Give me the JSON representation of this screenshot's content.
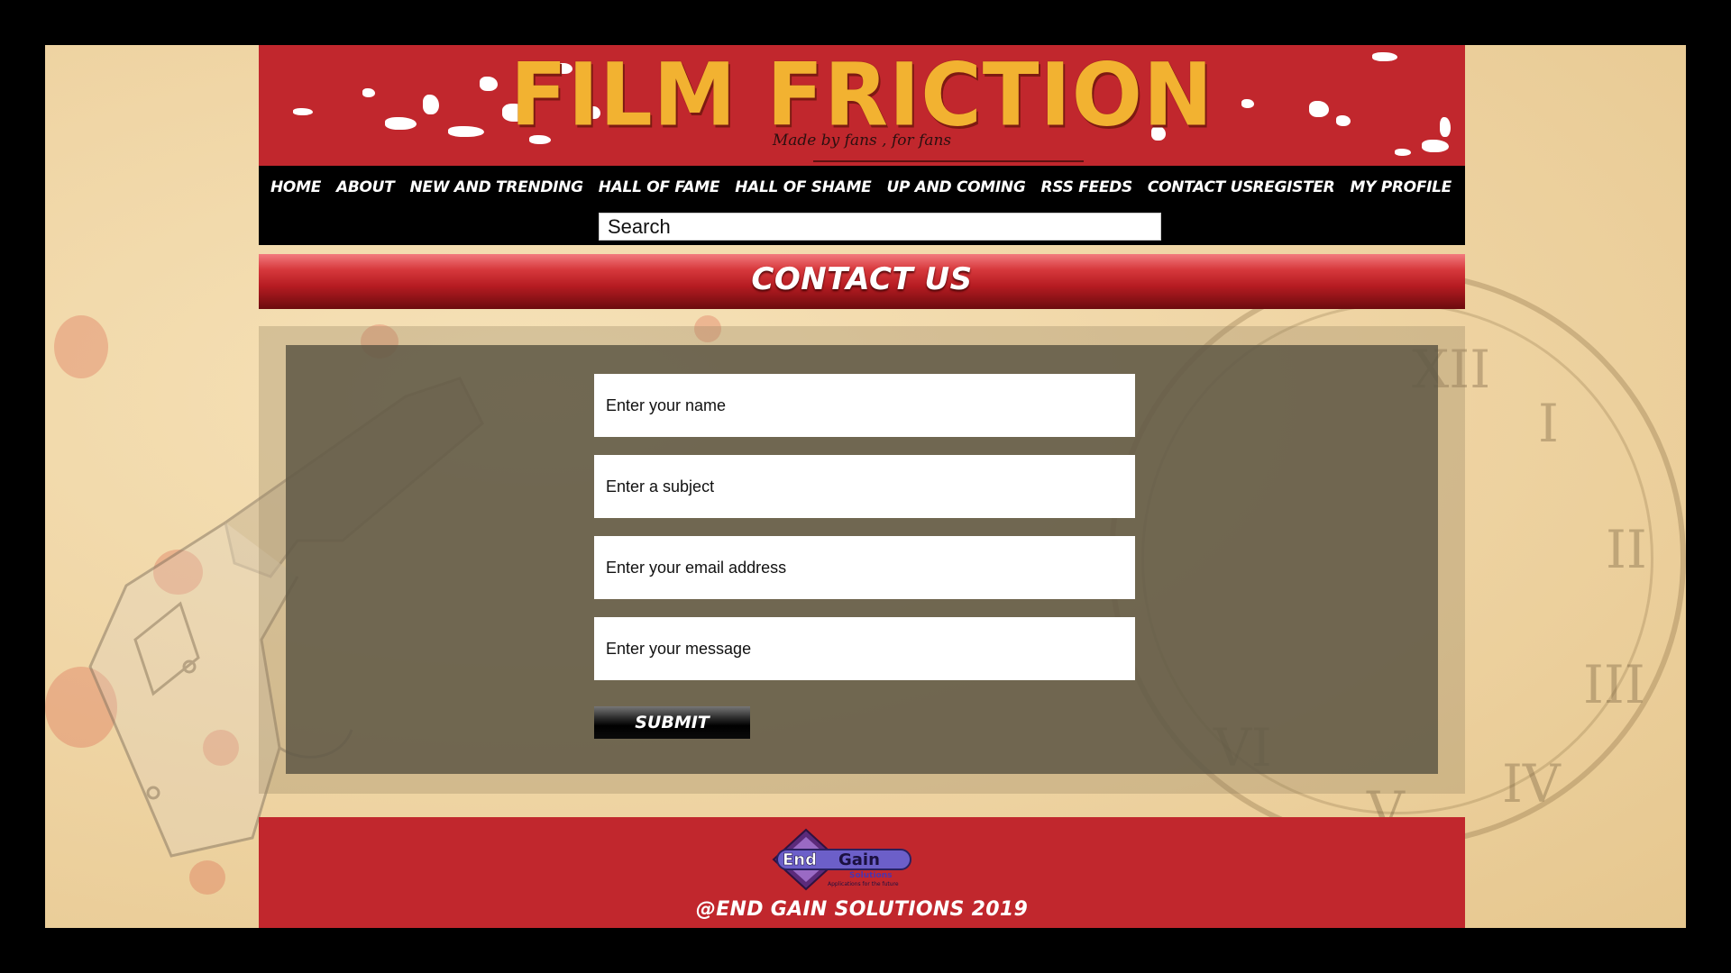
{
  "site": {
    "title": "FILM FRICTION",
    "tagline": "Made by fans , for fans"
  },
  "nav": {
    "left": [
      "HOME",
      "ABOUT",
      "NEW AND TRENDING",
      "HALL OF FAME",
      "HALL OF SHAME",
      "UP AND COMING",
      "RSS FEEDS",
      "CONTACT US"
    ],
    "right": [
      "REGISTER",
      "MY PROFILE"
    ]
  },
  "search": {
    "placeholder": "Search"
  },
  "page": {
    "heading": "CONTACT US"
  },
  "form": {
    "name_placeholder": "Enter your name",
    "subject_placeholder": "Enter a subject",
    "email_placeholder": "Enter your email address",
    "message_placeholder": "Enter your message",
    "submit_label": "SUBMIT"
  },
  "footer": {
    "logo": {
      "line1_a": "End",
      "line1_b": "Gain",
      "line2": "Solutions",
      "line3": "Applications for the future"
    },
    "copyright": "@END GAIN SOLUTIONS 2019"
  },
  "colors": {
    "brand_red": "#c1272d",
    "title_gold": "#f2b231",
    "nav_bg": "#000000"
  }
}
